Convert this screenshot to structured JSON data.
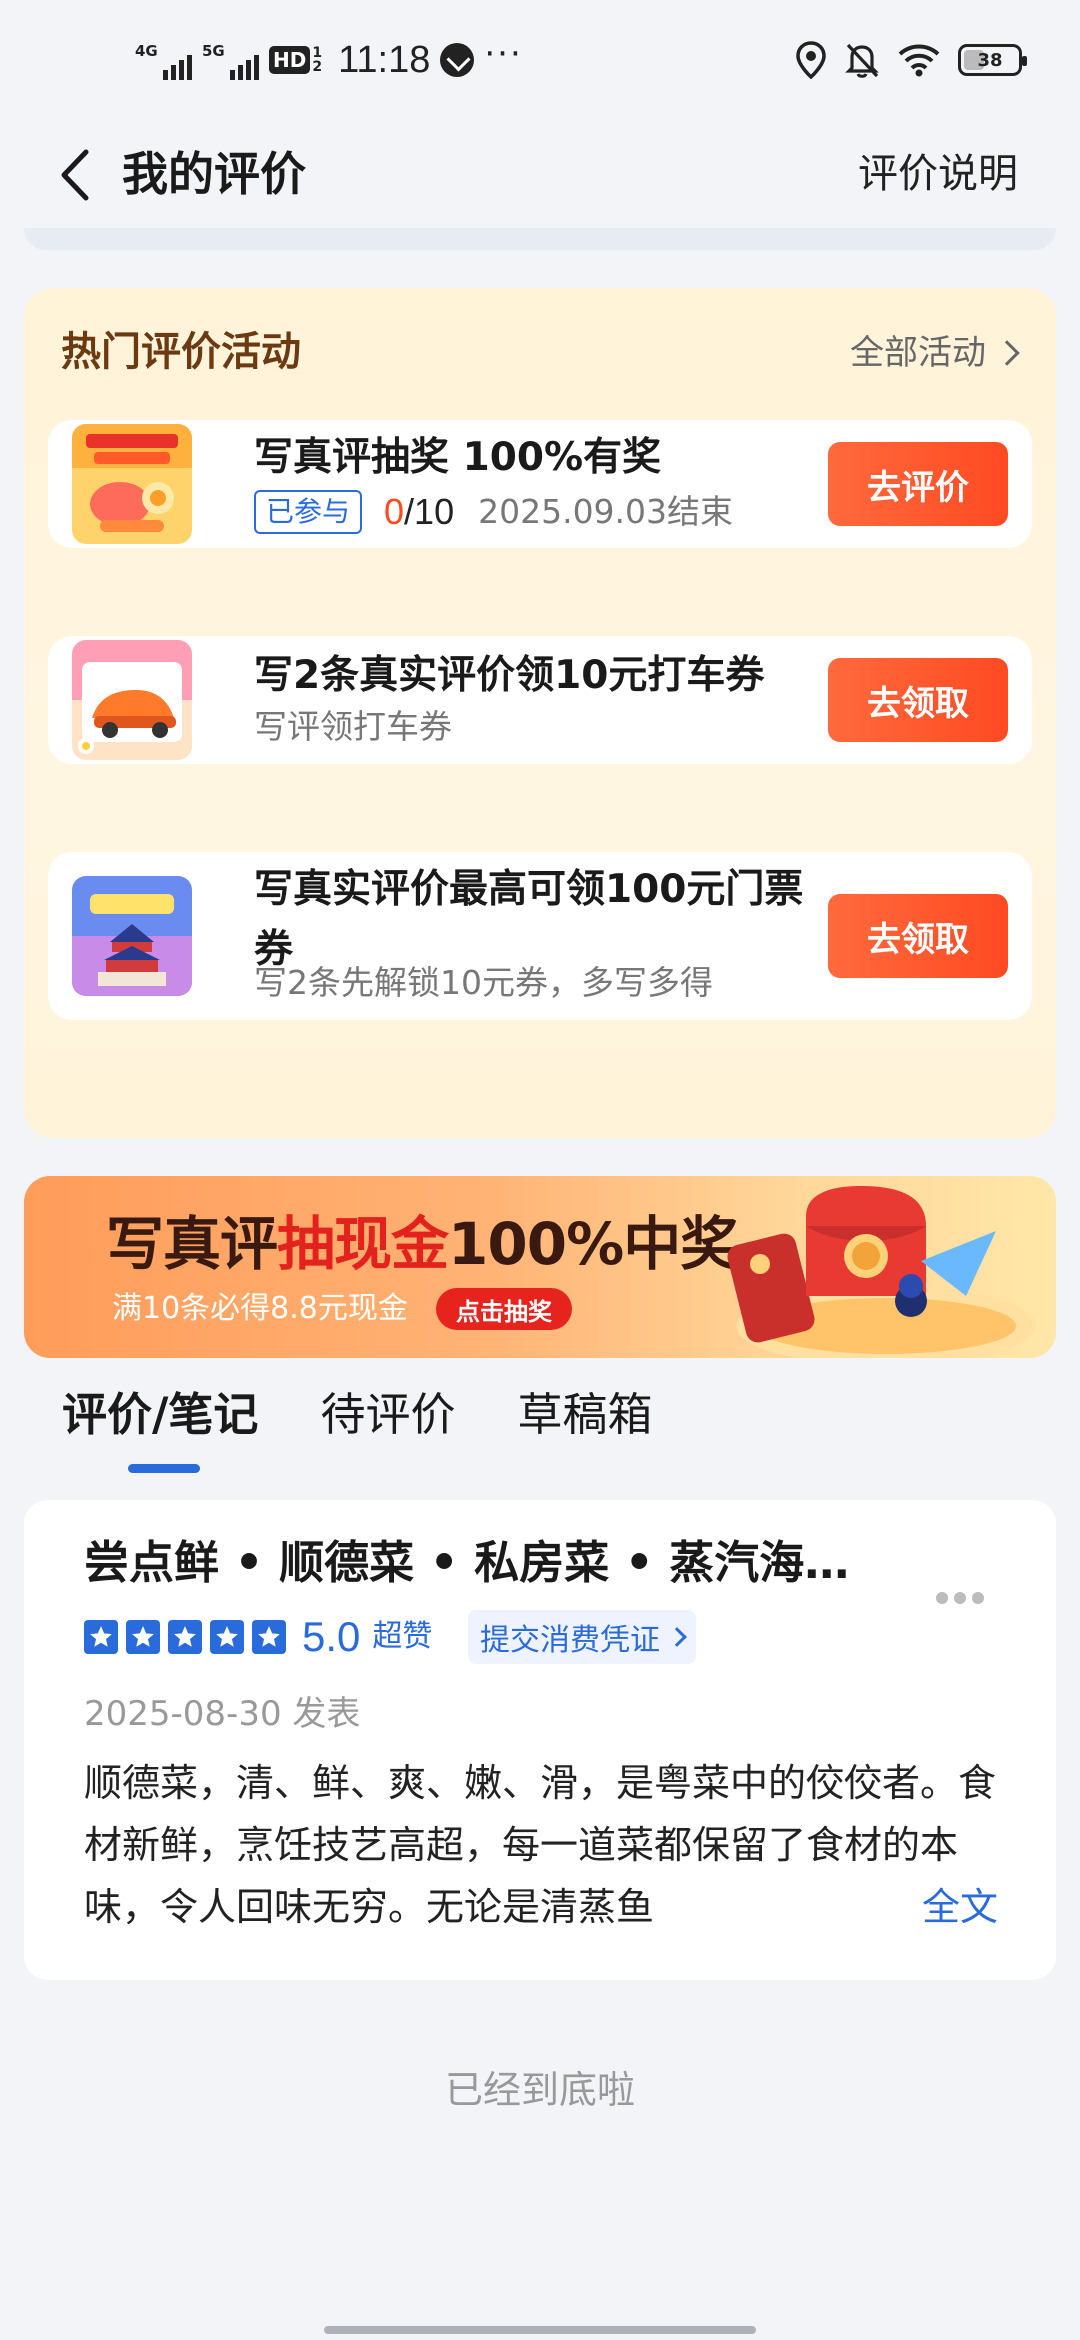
{
  "status_bar": {
    "sim1": "4G",
    "sim2": "5G",
    "hd": "HD",
    "hd_sub_top": "1",
    "hd_sub_bottom": "2",
    "time": "11:18",
    "more": "···",
    "battery": "38",
    "battery_level_percent": 38
  },
  "header": {
    "title": "我的评价",
    "help_link": "评价说明"
  },
  "activities": {
    "title": "热门评价活动",
    "all_link": "全部活动",
    "items": [
      {
        "title": "写真评抽奖 100%有奖",
        "badge": "已参与",
        "progress_done": "0",
        "progress_total": "/10",
        "end_date": "2025.09.03结束",
        "cta": "去评价"
      },
      {
        "title": "写2条真实评价领10元打车券",
        "subtitle": "写评领打车券",
        "cta": "去领取"
      },
      {
        "title_line1": "写真实评价最高可领100元门票",
        "title_line2": "券",
        "subtitle": "写2条先解锁10元券，多写多得",
        "cta": "去领取"
      }
    ]
  },
  "banner": {
    "title_a": "写真评",
    "title_b": "抽现金",
    "title_c": "100%中奖",
    "subtitle": "满10条必得8.8元现金",
    "button": "点击抽奖"
  },
  "tabs": [
    {
      "label": "评价/笔记",
      "active": true
    },
    {
      "label": "待评价",
      "active": false
    },
    {
      "label": "草稿箱",
      "active": false
    }
  ],
  "review": {
    "title": "尝点鲜 • 顺德菜 • 私房菜 • 蒸汽海…",
    "rating": "5.0",
    "rating_level": "超赞",
    "stars": 5,
    "voucher": "提交消费凭证",
    "date": "2025-08-30 发表",
    "body": "顺德菜，清、鲜、爽、嫩、滑，是粤菜中的佼佼者。食材新鲜，烹饪技艺高超，每一道菜都保留了食材的本味，令人回味无穷。无论是清蒸鱼",
    "full_text": "全文"
  },
  "footer_note": "已经到底啦",
  "colors": {
    "accent_blue": "#2a6bdc",
    "cta_orange": "#ff4a22",
    "activity_title": "#6b3a12",
    "activity_panel": "#fff3d8"
  }
}
